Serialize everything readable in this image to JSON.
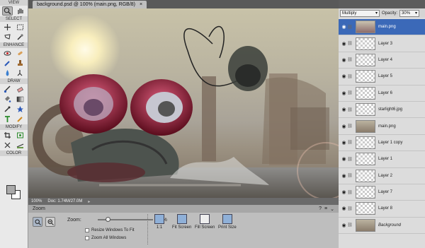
{
  "toolbar": {
    "sections": {
      "view": "VIEW",
      "select": "SELECT",
      "enhance": "ENHANCE",
      "draw": "DRAW",
      "modify": "MODIFY",
      "color": "COLOR"
    }
  },
  "document": {
    "tab_title": "background.psd @ 100% (main.png, RGB/8)",
    "close": "×"
  },
  "status": {
    "zoom": "100%",
    "doc": "Doc: 1.74M/27.0M"
  },
  "options": {
    "title": "Zoom",
    "zoom_label": "Zoom:",
    "zoom_value": "100%",
    "zoom_fraction": 0.18,
    "resize_windows": "Resize Windows To Fit",
    "zoom_all": "Zoom All Windows",
    "views": [
      "1:1",
      "Fit Screen",
      "Fill Screen",
      "Print Size"
    ]
  },
  "layers_panel": {
    "blend_mode": "Multiply",
    "opacity_label": "Opacity:",
    "opacity_value": "30%",
    "layers": [
      {
        "name": "main.png",
        "active": true,
        "thumb": "image"
      },
      {
        "name": "Layer 3",
        "active": false,
        "thumb": "transparent"
      },
      {
        "name": "Layer 4",
        "active": false,
        "thumb": "transparent"
      },
      {
        "name": "Layer 5",
        "active": false,
        "thumb": "transparent"
      },
      {
        "name": "Layer 6",
        "active": false,
        "thumb": "transparent"
      },
      {
        "name": "starlight6.jpg",
        "active": false,
        "thumb": "transparent"
      },
      {
        "name": "main.png",
        "active": false,
        "thumb": "image"
      },
      {
        "name": "Layer 1 copy",
        "active": false,
        "thumb": "transparent"
      },
      {
        "name": "Layer 1",
        "active": false,
        "thumb": "transparent"
      },
      {
        "name": "Layer 2",
        "active": false,
        "thumb": "transparent"
      },
      {
        "name": "Layer 7",
        "active": false,
        "thumb": "transparent"
      },
      {
        "name": "Layer 8",
        "active": false,
        "thumb": "transparent"
      },
      {
        "name": "Background",
        "active": false,
        "thumb": "image"
      }
    ]
  },
  "colors": {
    "active_layer": "#3b69b8",
    "panel_bg": "#dcdcdc",
    "toolbar_bg": "#e9e9e9"
  }
}
